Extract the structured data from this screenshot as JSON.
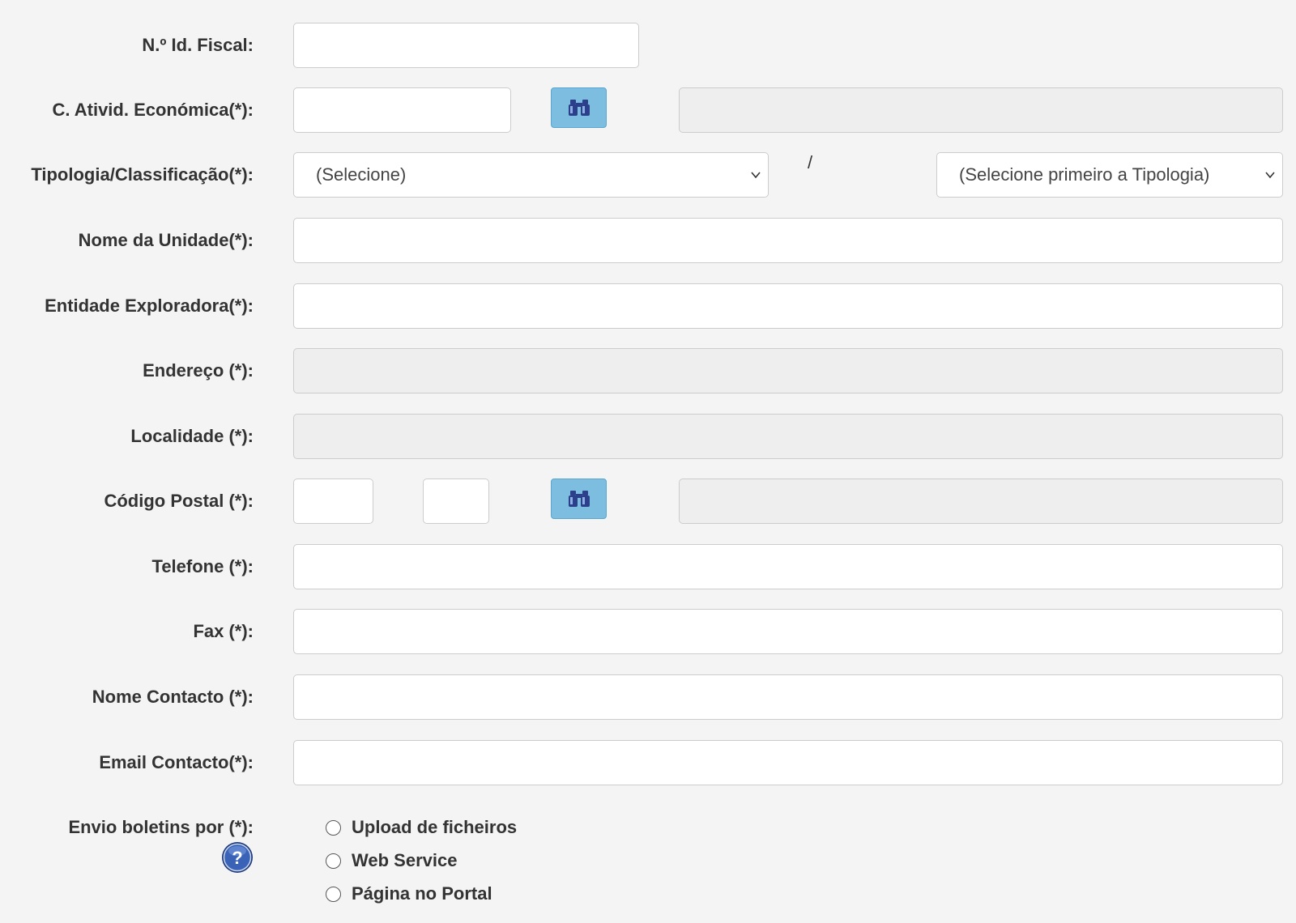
{
  "form": {
    "nif": {
      "label": "N.º Id. Fiscal:",
      "value": ""
    },
    "cae": {
      "label": "C. Ativid. Económica(*):",
      "value": "",
      "description": ""
    },
    "tipologia": {
      "label": "Tipologia/Classificação(*):",
      "select_value": "(Selecione)",
      "separator": "/",
      "classificacao_value": "(Selecione primeiro a Tipologia)"
    },
    "nome_unidade": {
      "label": "Nome da Unidade(*):",
      "value": ""
    },
    "entidade": {
      "label": "Entidade Exploradora(*):",
      "value": ""
    },
    "endereco": {
      "label": "Endereço (*):",
      "value": ""
    },
    "localidade": {
      "label": "Localidade (*):",
      "value": ""
    },
    "codigo_postal": {
      "label": "Código Postal (*):",
      "cp4": "",
      "cp3": "",
      "designacao": ""
    },
    "telefone": {
      "label": "Telefone (*):",
      "value": ""
    },
    "fax": {
      "label": "Fax (*):",
      "value": ""
    },
    "nome_contacto": {
      "label": "Nome Contacto (*):",
      "value": ""
    },
    "email_contacto": {
      "label": "Email Contacto(*):",
      "value": ""
    },
    "envio": {
      "label": "Envio boletins por (*):",
      "options": [
        "Upload de ficheiros",
        "Web Service",
        "Página no Portal"
      ],
      "selected": null
    }
  },
  "icons": {
    "search": "binoculars-icon",
    "help": "help-icon",
    "caret": "chevron-down-icon"
  },
  "colors": {
    "background": "#f4f4f4",
    "search_button": "#7cbde0",
    "readonly_field": "#eeeeee",
    "help_icon": "#2b4f9e"
  }
}
